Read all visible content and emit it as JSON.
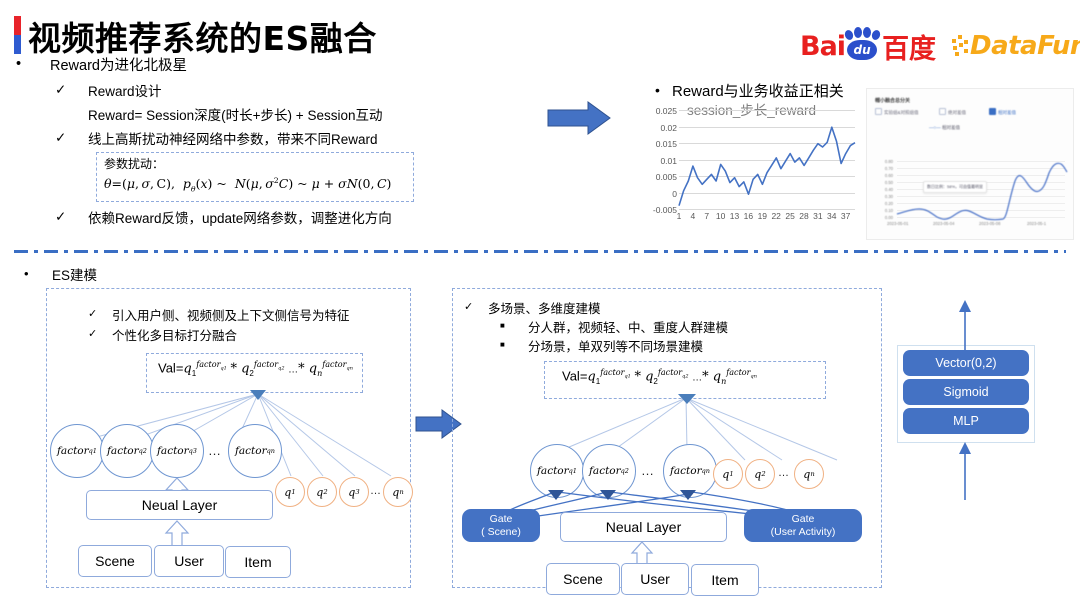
{
  "slide": {
    "title": "视频推荐系统的ES融合",
    "accent_red": "#e8232a",
    "accent_blue": "#2f5bd0"
  },
  "logos": {
    "baidu_latin": "Bai",
    "baidu_paw_text": "du",
    "baidu_cn": "百度",
    "datafun": "DataFun."
  },
  "upper": {
    "bullet1": "Reward为进化北极星",
    "check1": "Reward设计",
    "formula_line": "Reward= Session深度(时长+步长) + Session互动",
    "check2": "线上高斯扰动神经网络中参数，带来不同Reward",
    "box_label": "参数扰动：",
    "check3": "依赖Reward反馈，update网络参数，调整进化方向"
  },
  "chart_header": {
    "bullet": "Reward与业务收益正相关",
    "subtitle": "session_步长_reward"
  },
  "chart_data": {
    "type": "line",
    "title": "session_步长_reward",
    "xlabel": "",
    "ylabel": "",
    "ylim": [
      -0.005,
      0.025
    ],
    "yticks": [
      "0.025",
      "0.02",
      "0.015",
      "0.01",
      "0.005",
      "0",
      "-0.005"
    ],
    "xticks": [
      "1",
      "4",
      "7",
      "10",
      "13",
      "16",
      "19",
      "22",
      "25",
      "28",
      "31",
      "34",
      "37"
    ],
    "grid": true,
    "legend": "none",
    "series": [
      {
        "name": "session_步长_reward",
        "color": "#4472c4",
        "x": [
          1,
          2,
          3,
          4,
          5,
          6,
          7,
          8,
          9,
          10,
          11,
          12,
          13,
          14,
          15,
          16,
          17,
          18,
          19,
          20,
          21,
          22,
          23,
          24,
          25,
          26,
          27,
          28,
          29,
          30,
          31,
          32,
          33,
          34,
          35,
          36,
          37,
          38,
          39
        ],
        "values": [
          -0.004,
          0.0005,
          0.0035,
          0.008,
          0.0045,
          0.0025,
          0.004,
          0.0055,
          0.0035,
          0.0085,
          0.0065,
          0.003,
          0.0045,
          0.0018,
          0.0032,
          -0.0005,
          0.004,
          0.0055,
          0.0025,
          0.006,
          0.0082,
          0.0105,
          0.0072,
          0.0095,
          0.0118,
          0.0092,
          0.0105,
          0.0082,
          0.0105,
          0.0128,
          0.0148,
          0.0138,
          0.0152,
          0.0198,
          0.0155,
          0.0088,
          0.0118,
          0.0142,
          0.0151
        ]
      }
    ]
  },
  "dashboard": {
    "title": "帽小融合总分关",
    "legend": [
      {
        "label": "实验组&对照组值",
        "checked": false
      },
      {
        "label": "绝对差值",
        "checked": false
      },
      {
        "label": "相对差值",
        "checked": true
      }
    ],
    "series_label": "相对差值",
    "tooltip": "数日比例：58%，可由值最明显",
    "yticks": [
      "0.80",
      "0.70",
      "0.60",
      "0.50",
      "0.40",
      "0.30",
      "0.20",
      "0.10",
      "0.00"
    ],
    "xticks": [
      "2023-05-01",
      "2023-05-04",
      "2023-05-08",
      "2023-05-1"
    ]
  },
  "lower": {
    "bullet": "ES建模",
    "left_panel": {
      "check1": "引入用户侧、视频侧及上下文侧信号为特征",
      "check2": "个性化多目标打分融合",
      "neural_layer": "Neual Layer",
      "inputs": [
        "Scene",
        "User",
        "Item"
      ],
      "factors": [
        "factor",
        "factor",
        "factor",
        "factor"
      ],
      "q_nodes": [
        "q",
        "q",
        "q",
        "q"
      ]
    },
    "right_panel": {
      "check1": "多场景、多维度建模",
      "sub1": "分人群，视频轻、中、重度人群建模",
      "sub2": "分场景，单双列等不同场景建模",
      "neural_layer": "Neual Layer",
      "gate_left_line1": "Gate",
      "gate_left_line2": "( Scene)",
      "gate_right_line1": "Gate",
      "gate_right_line2": "(User Activity)",
      "inputs": [
        "Scene",
        "User",
        "Item"
      ]
    },
    "stack": [
      "Vector(0,2)",
      "Sigmoid",
      "MLP"
    ]
  }
}
